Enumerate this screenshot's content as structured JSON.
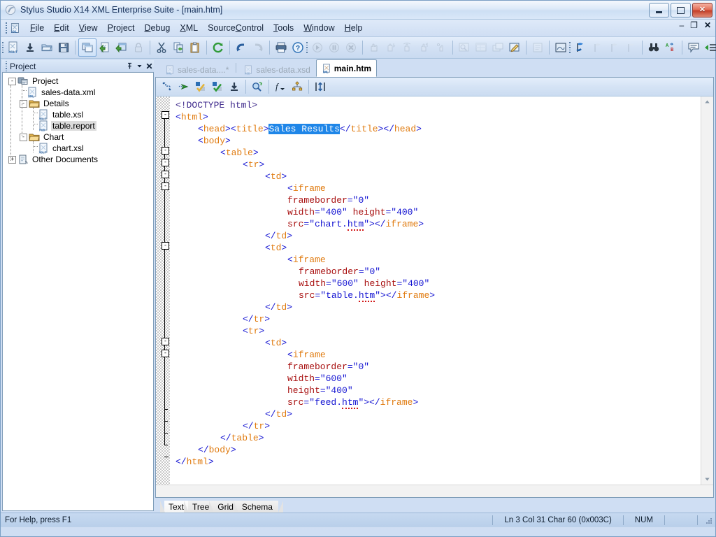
{
  "window": {
    "title": "Stylus Studio X14 XML Enterprise Suite - [main.htm]",
    "app_icon": "stylus-studio-icon",
    "minimize_label": "",
    "maximize_label": "",
    "close_label": "✕"
  },
  "menu": {
    "icon": "xml-document-icon",
    "items": [
      {
        "label": "File",
        "accel": "F"
      },
      {
        "label": "Edit",
        "accel": "E"
      },
      {
        "label": "View",
        "accel": "V"
      },
      {
        "label": "Project",
        "accel": "P"
      },
      {
        "label": "Debug",
        "accel": "D"
      },
      {
        "label": "XML",
        "accel": "X"
      },
      {
        "label": "SourceControl",
        "accel": "C"
      },
      {
        "label": "Tools",
        "accel": "T"
      },
      {
        "label": "Window",
        "accel": "W"
      },
      {
        "label": "Help",
        "accel": "H"
      }
    ],
    "mdi_minimize": "–",
    "mdi_restore": "❐",
    "mdi_close": "✕"
  },
  "toolbar": {
    "groups": [
      [
        "new-xslt-document-icon",
        "download-icon",
        "open-folder-icon",
        "save-icon"
      ],
      [
        "new-window-icon",
        "new-xml-document-icon",
        "open-document-icon",
        "lock-icon"
      ],
      [
        "cut-icon",
        "copy-icon",
        "paste-icon"
      ],
      [
        "refresh-icon"
      ],
      [
        "undo-icon",
        "redo-icon"
      ],
      [
        "print-icon",
        "help-icon"
      ]
    ],
    "debug_group": [
      "run-icon",
      "pause-icon",
      "stop-icon"
    ],
    "step_group": [
      "stop-hand-icon",
      "step-into-icon",
      "step-over-icon",
      "step-out-icon",
      "run-to-cursor-icon"
    ],
    "window_group": [
      "watch-window-icon",
      "variables-window-icon",
      "call-stack-icon",
      "edit-values-icon"
    ],
    "bookmark_group": [
      "notes-icon"
    ],
    "extra_group": [
      "screen-capture-icon"
    ],
    "right_group": [
      "flag-blue-icon",
      "flag-next-icon",
      "flag-prev-icon",
      "flag-clear-icon"
    ],
    "find_group": [
      "find-binoculars-icon",
      "replace-icon"
    ],
    "comment_group": [
      "comment-icon",
      "indent-icon",
      "outdent-icon"
    ]
  },
  "project_panel": {
    "title": "Project",
    "pin_icon": "pushpin-icon",
    "dropdown_icon": "chevron-down-icon",
    "close_icon": "close-icon",
    "tree": [
      {
        "label": "Project",
        "icon": "project-icon",
        "depth": 0,
        "toggle": "-",
        "selected": false
      },
      {
        "label": "sales-data.xml",
        "icon": "xml-file-icon",
        "depth": 1,
        "toggle": "",
        "selected": false
      },
      {
        "label": "Details",
        "icon": "folder-icon",
        "depth": 1,
        "toggle": "-",
        "selected": false
      },
      {
        "label": "table.xsl",
        "icon": "xslt-file-icon",
        "depth": 2,
        "toggle": "",
        "selected": false
      },
      {
        "label": "table.report",
        "icon": "report-file-icon",
        "depth": 2,
        "toggle": "",
        "selected": true
      },
      {
        "label": "Chart",
        "icon": "folder-icon",
        "depth": 1,
        "toggle": "-",
        "selected": false
      },
      {
        "label": "chart.xsl",
        "icon": "xslt-file-icon",
        "depth": 2,
        "toggle": "",
        "selected": false
      },
      {
        "label": "Other Documents",
        "icon": "other-documents-icon",
        "depth": 0,
        "toggle": "+",
        "selected": false
      }
    ]
  },
  "document_tabs": [
    {
      "label": "sales-data....*",
      "icon": "xml-file-icon",
      "active": false
    },
    {
      "label": "sales-data.xsd",
      "icon": "xsd-file-icon",
      "active": false
    },
    {
      "label": "main.htm",
      "icon": "xml-file-icon",
      "active": true
    }
  ],
  "editor_toolbar": {
    "icons": [
      "validate-wellformed-icon",
      "validate-document-icon",
      "check-markup-icon",
      "check-schema-icon",
      "download-schema-icon",
      "preview-icon",
      "function-icon",
      "node-tree-icon",
      "format-text-icon"
    ]
  },
  "code": {
    "selection_text": "Sales Results",
    "lines": [
      {
        "indent": 0,
        "fold": "none",
        "segs": [
          {
            "t": "<!DOCTYPE html>",
            "c": "dt"
          }
        ]
      },
      {
        "indent": 0,
        "fold": "box",
        "segs": [
          {
            "t": "<",
            "c": "br"
          },
          {
            "t": "html",
            "c": "tg"
          },
          {
            "t": ">",
            "c": "br"
          }
        ]
      },
      {
        "indent": 2,
        "fold": "line",
        "segs": [
          {
            "t": "<",
            "c": "br"
          },
          {
            "t": "head",
            "c": "tg"
          },
          {
            "t": "><",
            "c": "br"
          },
          {
            "t": "title",
            "c": "tg"
          },
          {
            "t": ">",
            "c": "br"
          },
          {
            "t": "Sales Results",
            "c": "sel"
          },
          {
            "t": "</",
            "c": "br"
          },
          {
            "t": "title",
            "c": "tg"
          },
          {
            "t": "></",
            "c": "br"
          },
          {
            "t": "head",
            "c": "tg"
          },
          {
            "t": ">",
            "c": "br"
          }
        ]
      },
      {
        "indent": 2,
        "fold": "box",
        "segs": [
          {
            "t": "<",
            "c": "br"
          },
          {
            "t": "body",
            "c": "tg"
          },
          {
            "t": ">",
            "c": "br"
          }
        ]
      },
      {
        "indent": 4,
        "fold": "box",
        "segs": [
          {
            "t": "<",
            "c": "br"
          },
          {
            "t": "table",
            "c": "tg"
          },
          {
            "t": ">",
            "c": "br"
          }
        ]
      },
      {
        "indent": 6,
        "fold": "box",
        "segs": [
          {
            "t": "<",
            "c": "br"
          },
          {
            "t": "tr",
            "c": "tg"
          },
          {
            "t": ">",
            "c": "br"
          }
        ]
      },
      {
        "indent": 8,
        "fold": "box",
        "segs": [
          {
            "t": "<",
            "c": "br"
          },
          {
            "t": "td",
            "c": "tg"
          },
          {
            "t": ">",
            "c": "br"
          }
        ]
      },
      {
        "indent": 10,
        "fold": "none",
        "segs": [
          {
            "t": "<",
            "c": "br"
          },
          {
            "t": "iframe",
            "c": "tg"
          }
        ]
      },
      {
        "indent": 10,
        "fold": "none",
        "segs": [
          {
            "t": "frameborder",
            "c": "at"
          },
          {
            "t": "=",
            "c": "br"
          },
          {
            "t": "\"0\"",
            "c": "vl"
          }
        ]
      },
      {
        "indent": 10,
        "fold": "none",
        "segs": [
          {
            "t": "width",
            "c": "at"
          },
          {
            "t": "=",
            "c": "br"
          },
          {
            "t": "\"400\"",
            "c": "vl"
          },
          {
            "t": " ",
            "c": "br"
          },
          {
            "t": "height",
            "c": "at"
          },
          {
            "t": "=",
            "c": "br"
          },
          {
            "t": "\"400\"",
            "c": "vl"
          }
        ]
      },
      {
        "indent": 10,
        "fold": "none",
        "segs": [
          {
            "t": "src",
            "c": "at"
          },
          {
            "t": "=",
            "c": "br"
          },
          {
            "t": "\"chart.",
            "c": "vl"
          },
          {
            "t": "htm",
            "c": "vl sq"
          },
          {
            "t": "\">",
            "c": "vl"
          },
          {
            "t": "</",
            "c": "br"
          },
          {
            "t": "iframe",
            "c": "tg"
          },
          {
            "t": ">",
            "c": "br"
          }
        ]
      },
      {
        "indent": 8,
        "fold": "none",
        "segs": [
          {
            "t": "</",
            "c": "br"
          },
          {
            "t": "td",
            "c": "tg"
          },
          {
            "t": ">",
            "c": "br"
          }
        ]
      },
      {
        "indent": 8,
        "fold": "box",
        "segs": [
          {
            "t": "<",
            "c": "br"
          },
          {
            "t": "td",
            "c": "tg"
          },
          {
            "t": ">",
            "c": "br"
          }
        ]
      },
      {
        "indent": 10,
        "fold": "none",
        "segs": [
          {
            "t": "<",
            "c": "br"
          },
          {
            "t": "iframe",
            "c": "tg"
          }
        ]
      },
      {
        "indent": 11,
        "fold": "none",
        "segs": [
          {
            "t": "frameborder",
            "c": "at"
          },
          {
            "t": "=",
            "c": "br"
          },
          {
            "t": "\"0\"",
            "c": "vl"
          }
        ]
      },
      {
        "indent": 11,
        "fold": "none",
        "segs": [
          {
            "t": "width",
            "c": "at"
          },
          {
            "t": "=",
            "c": "br"
          },
          {
            "t": "\"600\"",
            "c": "vl"
          },
          {
            "t": " ",
            "c": "br"
          },
          {
            "t": "height",
            "c": "at"
          },
          {
            "t": "=",
            "c": "br"
          },
          {
            "t": "\"400\"",
            "c": "vl"
          }
        ]
      },
      {
        "indent": 11,
        "fold": "none",
        "segs": [
          {
            "t": "src",
            "c": "at"
          },
          {
            "t": "=",
            "c": "br"
          },
          {
            "t": "\"table.",
            "c": "vl"
          },
          {
            "t": "htm",
            "c": "vl sq"
          },
          {
            "t": "\">",
            "c": "vl"
          },
          {
            "t": "</",
            "c": "br"
          },
          {
            "t": "iframe",
            "c": "tg"
          },
          {
            "t": ">",
            "c": "br"
          }
        ]
      },
      {
        "indent": 8,
        "fold": "none",
        "segs": [
          {
            "t": "</",
            "c": "br"
          },
          {
            "t": "td",
            "c": "tg"
          },
          {
            "t": ">",
            "c": "br"
          }
        ]
      },
      {
        "indent": 6,
        "fold": "none",
        "segs": [
          {
            "t": "</",
            "c": "br"
          },
          {
            "t": "tr",
            "c": "tg"
          },
          {
            "t": ">",
            "c": "br"
          }
        ]
      },
      {
        "indent": 6,
        "fold": "box",
        "segs": [
          {
            "t": "<",
            "c": "br"
          },
          {
            "t": "tr",
            "c": "tg"
          },
          {
            "t": ">",
            "c": "br"
          }
        ]
      },
      {
        "indent": 8,
        "fold": "box",
        "segs": [
          {
            "t": "<",
            "c": "br"
          },
          {
            "t": "td",
            "c": "tg"
          },
          {
            "t": ">",
            "c": "br"
          }
        ]
      },
      {
        "indent": 10,
        "fold": "none",
        "segs": [
          {
            "t": "<",
            "c": "br"
          },
          {
            "t": "iframe",
            "c": "tg"
          }
        ]
      },
      {
        "indent": 10,
        "fold": "none",
        "segs": [
          {
            "t": "frameborder",
            "c": "at"
          },
          {
            "t": "=",
            "c": "br"
          },
          {
            "t": "\"0\"",
            "c": "vl"
          }
        ]
      },
      {
        "indent": 10,
        "fold": "none",
        "segs": [
          {
            "t": "width",
            "c": "at"
          },
          {
            "t": "=",
            "c": "br"
          },
          {
            "t": "\"600\"",
            "c": "vl"
          }
        ]
      },
      {
        "indent": 10,
        "fold": "none",
        "segs": [
          {
            "t": "height",
            "c": "at"
          },
          {
            "t": "=",
            "c": "br"
          },
          {
            "t": "\"400\"",
            "c": "vl"
          }
        ]
      },
      {
        "indent": 10,
        "fold": "none",
        "segs": [
          {
            "t": "src",
            "c": "at"
          },
          {
            "t": "=",
            "c": "br"
          },
          {
            "t": "\"feed.",
            "c": "vl"
          },
          {
            "t": "htm",
            "c": "vl sq"
          },
          {
            "t": "\">",
            "c": "vl"
          },
          {
            "t": "</",
            "c": "br"
          },
          {
            "t": "iframe",
            "c": "tg"
          },
          {
            "t": ">",
            "c": "br"
          }
        ]
      },
      {
        "indent": 8,
        "fold": "none",
        "segs": [
          {
            "t": "</",
            "c": "br"
          },
          {
            "t": "td",
            "c": "tg"
          },
          {
            "t": ">",
            "c": "br"
          }
        ]
      },
      {
        "indent": 6,
        "fold": "none",
        "segs": [
          {
            "t": "</",
            "c": "br"
          },
          {
            "t": "tr",
            "c": "tg"
          },
          {
            "t": ">",
            "c": "br"
          }
        ]
      },
      {
        "indent": 4,
        "fold": "none",
        "segs": [
          {
            "t": "</",
            "c": "br"
          },
          {
            "t": "table",
            "c": "tg"
          },
          {
            "t": ">",
            "c": "br"
          }
        ]
      },
      {
        "indent": 2,
        "fold": "none",
        "segs": [
          {
            "t": "</",
            "c": "br"
          },
          {
            "t": "body",
            "c": "tg"
          },
          {
            "t": ">",
            "c": "br"
          }
        ]
      },
      {
        "indent": 0,
        "fold": "end",
        "segs": [
          {
            "t": "</",
            "c": "br"
          },
          {
            "t": "html",
            "c": "tg"
          },
          {
            "t": ">",
            "c": "br"
          }
        ]
      }
    ]
  },
  "view_tabs": [
    {
      "label": "Text",
      "active": true
    },
    {
      "label": "Tree",
      "active": false
    },
    {
      "label": "Grid",
      "active": false
    },
    {
      "label": "Schema",
      "active": false
    }
  ],
  "status_bar": {
    "hint": "For Help, press F1",
    "position": "Ln 3 Col 31  Char 60 (0x003C)",
    "num_lock": "NUM",
    "resize_grip": "resize-grip-icon"
  },
  "colors": {
    "accent": "#1f86e8",
    "tag": "#e07b10",
    "bracket": "#1414d2",
    "attribute": "#a81010",
    "value": "#1414d2",
    "doctype": "#3f2a8c",
    "error_squiggle": "#d21818",
    "chrome": "#cfdef3"
  }
}
